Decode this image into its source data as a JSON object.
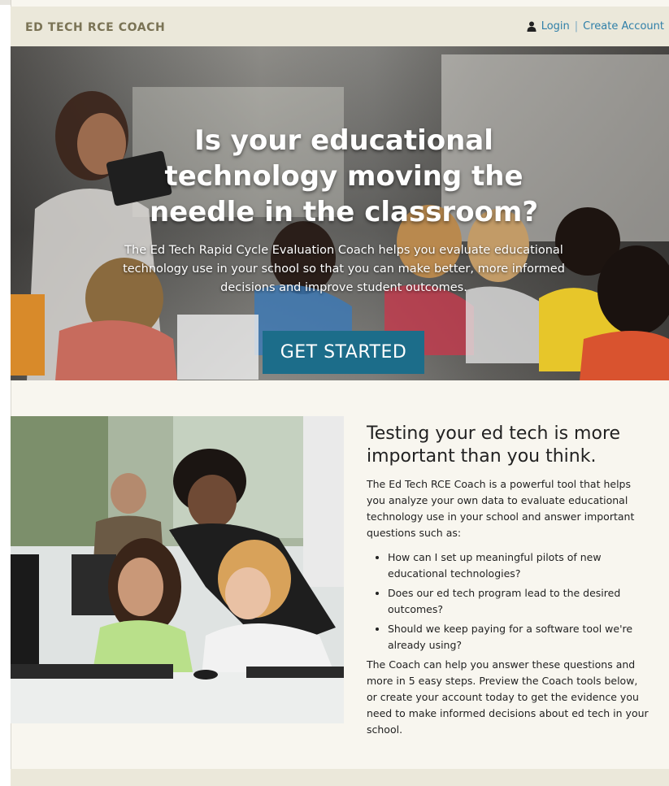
{
  "header": {
    "brand": "ED TECH RCE COACH",
    "login": "Login",
    "separator": "|",
    "create_account": "Create Account"
  },
  "hero": {
    "title": "Is your educational technology moving the needle in the classroom?",
    "subtitle": "The Ed Tech Rapid Cycle Evaluation Coach helps you evaluate educational technology use in your school so that you can make better, more informed decisions and improve student outcomes.",
    "cta_label": "GET STARTED"
  },
  "section": {
    "heading": "Testing your ed tech is more important than you think.",
    "intro": "The Ed Tech RCE Coach is a powerful tool that helps you analyze your own data to evaluate educational technology use in your school and answer important questions such as:",
    "questions": [
      "How can I set up meaningful pilots of new educational technologies?",
      "Does our ed tech program lead to the desired outcomes?",
      "Should we keep paying for a software tool we're already using?"
    ],
    "closing": "The Coach can help you answer these questions and more in 5 easy steps. Preview the Coach tools below, or create your account today to get the evidence you need to make informed decisions about ed tech in your school."
  },
  "colors": {
    "brand_text": "#7a7355",
    "link": "#2f7fa8",
    "cta_background": "#1c6d8a",
    "header_background": "#ebe8da",
    "page_background": "#f8f6ef"
  },
  "icons": {
    "user": "user-icon"
  }
}
